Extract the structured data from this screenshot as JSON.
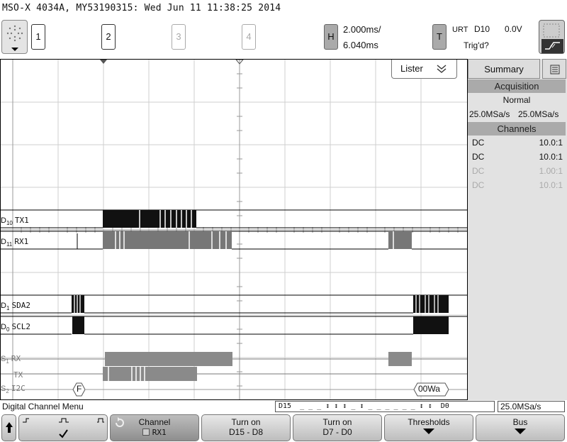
{
  "header": {
    "title": "MSO-X 4034A, MY53190315: Wed Jun 11 11:38:25 2014"
  },
  "channels": [
    {
      "label": "1"
    },
    {
      "label": "2"
    },
    {
      "label": "3"
    },
    {
      "label": "4"
    }
  ],
  "horizontal": {
    "key": "H",
    "scale": "2.000ms/",
    "delay": "6.040ms"
  },
  "trigger": {
    "key": "T",
    "mode": "URT",
    "source": "D10",
    "level": "0.0V",
    "status": "Trig'd?"
  },
  "lister": {
    "label": "Lister"
  },
  "traces": [
    {
      "prefix": "D",
      "sub": "10",
      "name": "TX1"
    },
    {
      "prefix": "D",
      "sub": "11",
      "name": "RX1"
    },
    {
      "prefix": "D",
      "sub": "1",
      "name": "SDA2"
    },
    {
      "prefix": "D",
      "sub": "0",
      "name": "SCL2"
    },
    {
      "prefix": "S",
      "sub": "1",
      "name": "RX"
    },
    {
      "prefix": "",
      "sub": "",
      "name": "TX"
    },
    {
      "prefix": "S",
      "sub": "2",
      "name": "I2C"
    }
  ],
  "bus_labels": {
    "i2c_start": "F",
    "i2c_end": "00Wa"
  },
  "sidebar": {
    "tab_summary": "Summary",
    "acquisition_header": "Acquisition",
    "acq_mode": "Normal",
    "acq_rate_1": "25.0MSa/s",
    "acq_rate_2": "25.0MSa/s",
    "channels_header": "Channels",
    "channel_rows": [
      {
        "coupling": "DC",
        "probe": "10.0:1",
        "active": true
      },
      {
        "coupling": "DC",
        "probe": "10.0:1",
        "active": true
      },
      {
        "coupling": "DC",
        "probe": "1.00:1",
        "active": false
      },
      {
        "coupling": "DC",
        "probe": "10.0:1",
        "active": false
      }
    ]
  },
  "status_bar": {
    "menu_title": "Digital Channel Menu",
    "digital_start": "D15",
    "digital_end": "D0",
    "digital_pattern": "_ _ _ ↕   ↕ ↕ _ ↕   _ _ _ _   _ _ ↕ ↕",
    "sample_rate": "25.0MSa/s"
  },
  "softkeys": {
    "channel_label": "Channel",
    "channel_value": "RX1",
    "turn_on_high_l1": "Turn on",
    "turn_on_high_l2": "D15 - D8",
    "turn_on_low_l1": "Turn on",
    "turn_on_low_l2": "D7 - D0",
    "thresholds": "Thresholds",
    "bus": "Bus"
  }
}
